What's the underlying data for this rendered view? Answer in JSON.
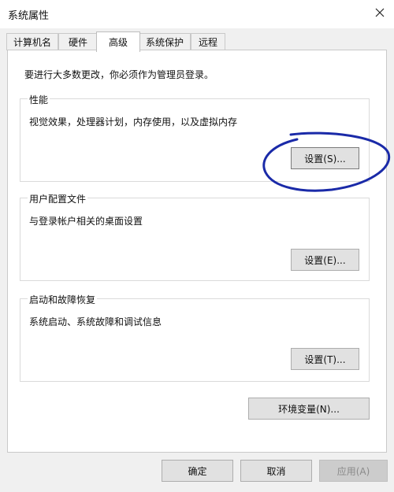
{
  "window": {
    "title": "系统属性"
  },
  "tabs": [
    "计算机名",
    "硬件",
    "高级",
    "系统保护",
    "远程"
  ],
  "notice": "要进行大多数更改，你必须作为管理员登录。",
  "performance": {
    "title": "性能",
    "description": "视觉效果，处理器计划，内存使用，以及虚拟内存",
    "button": "设置(S)..."
  },
  "user_profiles": {
    "title": "用户配置文件",
    "description": "与登录帐户相关的桌面设置",
    "button": "设置(E)..."
  },
  "startup_recovery": {
    "title": "启动和故障恢复",
    "description": "系统启动、系统故障和调试信息",
    "button": "设置(T)..."
  },
  "env_button": "环境变量(N)...",
  "footer": {
    "ok": "确定",
    "cancel": "取消",
    "apply": "应用(A)"
  },
  "colors": {
    "annotation": "#1a2aa8",
    "panel_bg": "#ffffff",
    "window_bg": "#f0f0f0"
  }
}
